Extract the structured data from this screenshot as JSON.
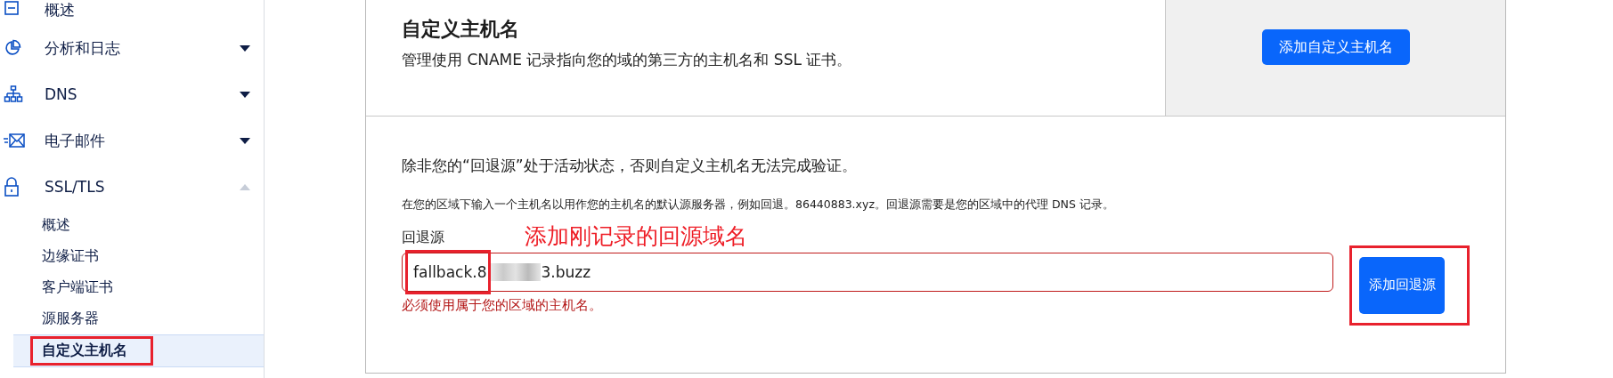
{
  "sidebar": {
    "items": [
      {
        "label": "概述"
      },
      {
        "label": "分析和日志",
        "expanded": false
      },
      {
        "label": "DNS",
        "expanded": false
      },
      {
        "label": "电子邮件",
        "expanded": false
      },
      {
        "label": "SSL/TLS",
        "expanded": true,
        "children": [
          {
            "label": "概述",
            "selected": false,
            "highlighted": false
          },
          {
            "label": "边缘证书",
            "selected": false,
            "highlighted": false
          },
          {
            "label": "客户端证书",
            "selected": false,
            "highlighted": false
          },
          {
            "label": "源服务器",
            "selected": false,
            "highlighted": false
          },
          {
            "label": "自定义主机名",
            "selected": true,
            "highlighted": true
          }
        ]
      }
    ]
  },
  "card": {
    "title": "自定义主机名",
    "description": "管理使用 CNAME 记录指向您的域的第三方的主机名和 SSL 证书。",
    "action": {
      "label": "添加自定义主机名",
      "highlighted": false
    }
  },
  "fallback": {
    "notice": "除非您的“回退源”处于活动状态，否则自定义主机名无法完成验证。",
    "help": "在您的区域下输入一个主机名以用作您的主机名的默认源服务器，例如回退。86440883.xyz。回退源需要是您的区域中的代理 DNS 记录。",
    "annotation": "添加刚记录的回源域名",
    "field_label": "回退源",
    "field": {
      "value_start": "fallback.8",
      "value_end": "3.buzz",
      "redacted": true,
      "start_highlighted": true,
      "invalid": true
    },
    "error": "必须使用属于您的区域的主机名。",
    "button": {
      "label": "添加回退源",
      "highlighted": true
    }
  }
}
